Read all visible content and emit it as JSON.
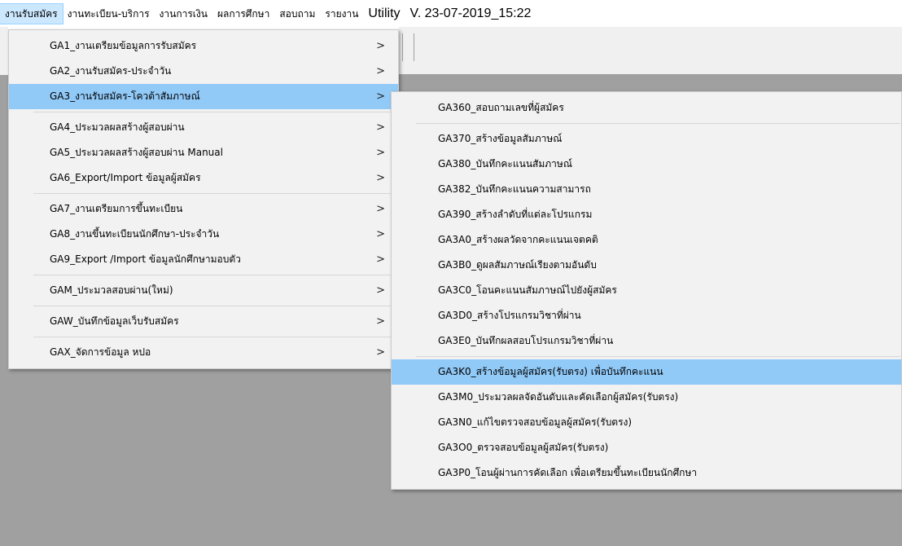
{
  "menubar": {
    "items": [
      {
        "label": "งานรับสมัคร"
      },
      {
        "label": "งานทะเบียน-บริการ"
      },
      {
        "label": "งานการเงิน"
      },
      {
        "label": "ผลการศึกษา"
      },
      {
        "label": "สอบถาม"
      },
      {
        "label": "รายงาน"
      },
      {
        "label": "Utility"
      },
      {
        "label": "V. 23-07-2019_15:22"
      }
    ]
  },
  "menu_main": {
    "items": [
      {
        "label": "GA1_งานเตรียมข้อมูลการรับสมัคร",
        "arrow": ">"
      },
      {
        "label": "GA2_งานรับสมัคร-ประจำวัน",
        "arrow": ">"
      },
      {
        "label": "GA3_งานรับสมัคร-โควต้าสัมภาษณ์",
        "arrow": ">"
      },
      {
        "label": "GA4_ประมวลผลสร้างผู้สอบผ่าน",
        "arrow": ">"
      },
      {
        "label": "GA5_ประมวลผลสร้างผู้สอบผ่าน Manual",
        "arrow": ">"
      },
      {
        "label": "GA6_Export/Import ข้อมูลผู้สมัคร",
        "arrow": ">"
      },
      {
        "label": "GA7_งานเตรียมการขึ้นทะเบียน",
        "arrow": ">"
      },
      {
        "label": "GA8_งานขึ้นทะเบียนนักศึกษา-ประจำวัน",
        "arrow": ">"
      },
      {
        "label": "GA9_Export /Import ข้อมูลนักศึกษามอบตัว",
        "arrow": ">"
      },
      {
        "label": "GAM_ประมวลสอบผ่าน(ใหม่)",
        "arrow": ">"
      },
      {
        "label": "GAW_บันทึกข้อมูลเว็บรับสมัคร",
        "arrow": ">"
      },
      {
        "label": "GAX_จัดการข้อมูล หปอ",
        "arrow": ">"
      }
    ]
  },
  "menu_sub": {
    "items": [
      {
        "label": "GA360_สอบถามเลขที่ผู้สมัคร"
      },
      {
        "label": "GA370_สร้างข้อมูลสัมภาษณ์"
      },
      {
        "label": "GA380_บันทึกคะแนนสัมภาษณ์"
      },
      {
        "label": "GA382_บันทึกคะแนนความสามารถ"
      },
      {
        "label": "GA390_สร้างลำดับที่แต่ละโปรแกรม"
      },
      {
        "label": "GA3A0_สร้างผลวัดจากคะแนนเจตคติ"
      },
      {
        "label": "GA3B0_ดูผลสัมภาษณ์เรียงตามอันดับ"
      },
      {
        "label": "GA3C0_โอนคะแนนสัมภาษณ์ไปยังผู้สมัคร"
      },
      {
        "label": "GA3D0_สร้างโปรแกรมวิชาที่ผ่าน"
      },
      {
        "label": "GA3E0_บันทึกผลสอบโปรแกรมวิชาที่ผ่าน"
      },
      {
        "label": "GA3K0_สร้างข้อมูลผู้สมัคร(รับตรง) เพื่อบันทึกคะแนน"
      },
      {
        "label": "GA3M0_ประมวลผลจัดอันดับและคัดเลือกผู้สมัคร(รับตรง)"
      },
      {
        "label": "GA3N0_แก้ไขตรวจสอบข้อมูลผู้สมัคร(รับตรง)"
      },
      {
        "label": "GA3O0_ตรวจสอบข้อมูลผู้สมัคร(รับตรง)"
      },
      {
        "label": "GA3P0_โอนผู้ผ่านการคัดเลือก เพื่อเตรียมขึ้นทะเบียนนักศึกษา"
      }
    ]
  },
  "colors": {
    "highlight": "#91c9f7",
    "menubar_active": "#cce8ff",
    "workspace": "#a0a0a0"
  }
}
